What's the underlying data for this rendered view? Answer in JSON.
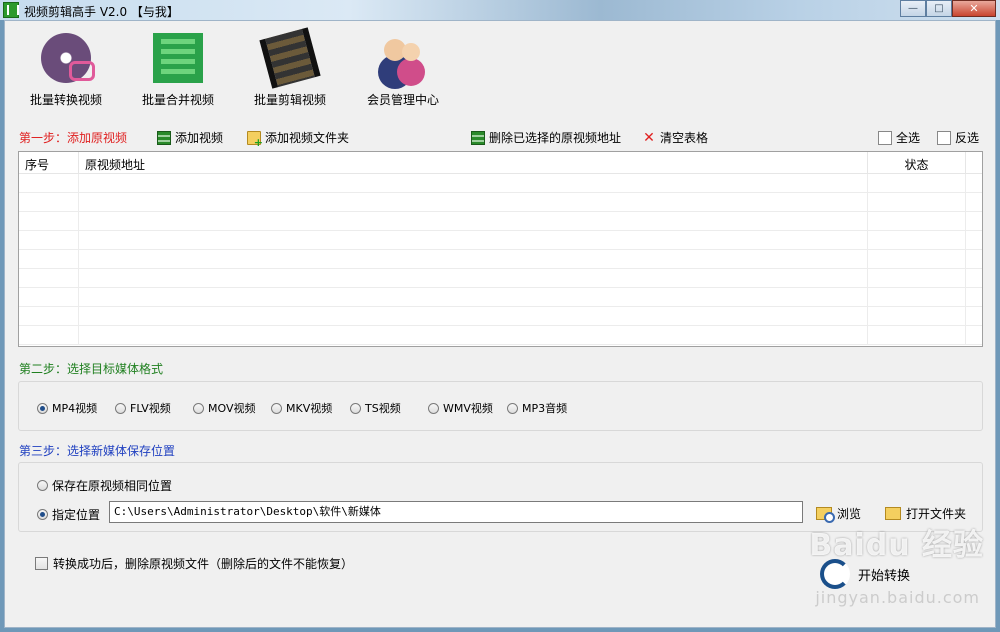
{
  "window": {
    "title": "视频剪辑高手 V2.0  【与我】",
    "minimize": "—",
    "maximize": "□",
    "close": "✕"
  },
  "toolbar": {
    "items": [
      {
        "label": "批量转换视频",
        "icon": "video-convert-icon"
      },
      {
        "label": "批量合并视频",
        "icon": "video-merge-icon"
      },
      {
        "label": "批量剪辑视频",
        "icon": "film-cut-icon"
      },
      {
        "label": "会员管理中心",
        "icon": "users-icon"
      }
    ]
  },
  "step1": {
    "title": "第一步：添加原视频",
    "add_video": "添加视频",
    "add_folder": "添加视频文件夹",
    "delete_selected": "删除已选择的原视频地址",
    "clear_table": "清空表格",
    "select_all": "全选",
    "invert_select": "反选"
  },
  "table": {
    "columns": [
      "序号",
      "原视频地址",
      "状态"
    ],
    "rows": []
  },
  "step2": {
    "title": "第二步：选择目标媒体格式",
    "formats": [
      "MP4视频",
      "FLV视频",
      "MOV视频",
      "MKV视频",
      "TS视频",
      "WMV视频",
      "MP3音频"
    ],
    "selected": "MP4视频"
  },
  "step3": {
    "title": "第三步：选择新媒体保存位置",
    "same_location": "保存在原视频相同位置",
    "specified_location": "指定位置",
    "path": "C:\\Users\\Administrator\\Desktop\\软件\\新媒体",
    "browse": "浏览",
    "open_folder": "打开文件夹"
  },
  "options": {
    "delete_after": "转换成功后，删除原视频文件（删除后的文件不能恢复）"
  },
  "start": {
    "label": "开始转换"
  },
  "watermark": {
    "brand": "Baidu 经验",
    "url": "jingyan.baidu.com"
  }
}
